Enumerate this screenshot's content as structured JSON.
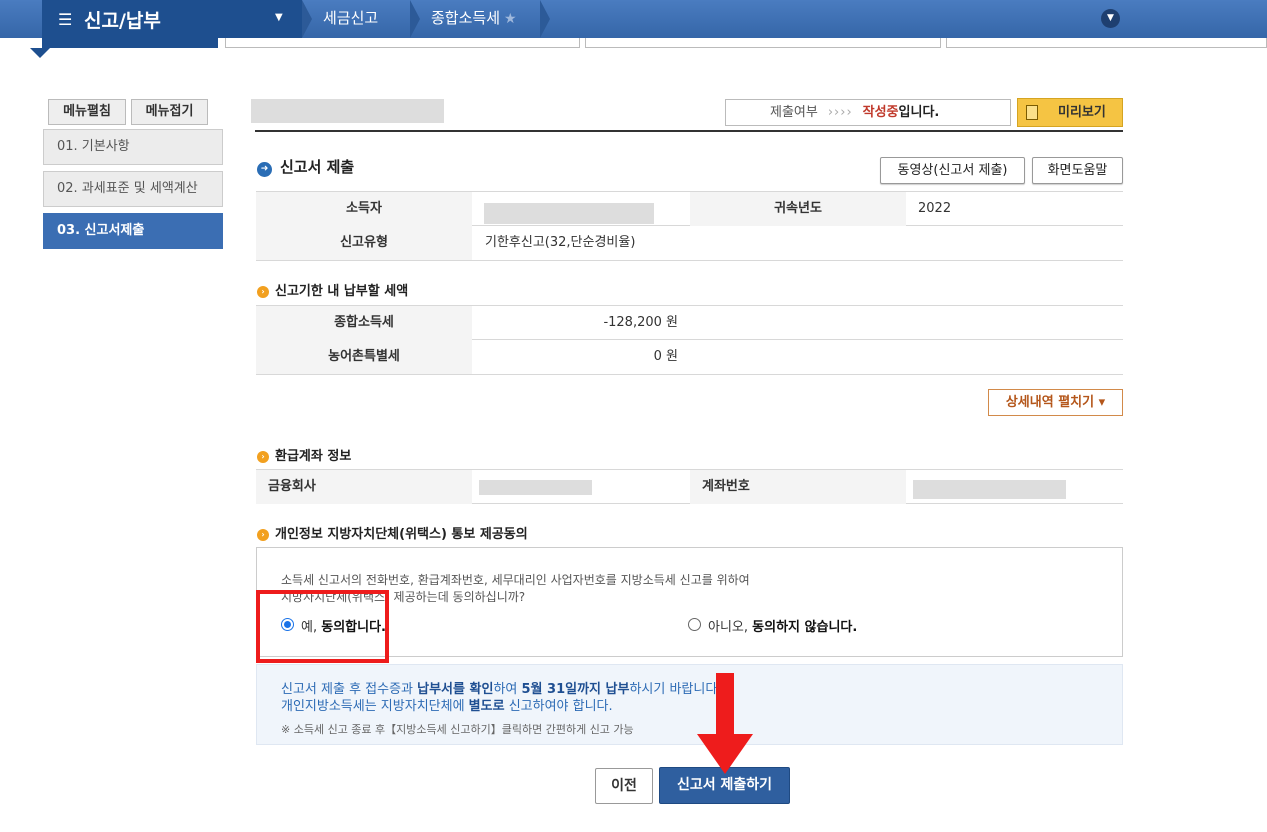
{
  "topnav": {
    "menu_title": "신고/납부",
    "breadcrumb": [
      "세금신고",
      "종합소득세"
    ]
  },
  "sidebar": {
    "edit_label": "메뉴펼침",
    "collapse_label": "메뉴접기",
    "items": [
      {
        "label": "01. 기본사항",
        "active": false
      },
      {
        "label": "02. 과세표준 및 세액계산",
        "active": false
      },
      {
        "label": "03. 신고서제출",
        "active": true
      }
    ]
  },
  "header": {
    "status_prefix": "제출여부",
    "status_arrows": "››››",
    "status_value": "작성중",
    "status_suffix": "입니다.",
    "preview_label": "미리보기"
  },
  "section_main": {
    "title": "신고서 제출",
    "video_btn": "동영상(신고서 제출)",
    "help_btn": "화면도움말",
    "rows": [
      {
        "label": "소득자",
        "value": "",
        "label2": "귀속년도",
        "value2": "2022"
      },
      {
        "label": "신고유형",
        "value": "기한후신고(32,단순경비율)"
      }
    ]
  },
  "section_tax": {
    "title": "신고기한 내 납부할 세액",
    "rows": [
      {
        "label": "종합소득세",
        "value": "-128,200 원"
      },
      {
        "label": "농어촌특별세",
        "value": "0 원"
      }
    ],
    "detail_btn": "상세내역 펼치기 ▾"
  },
  "section_refund": {
    "title": "환급계좌 정보",
    "bank_label": "금융회사",
    "account_label": "계좌번호"
  },
  "section_consent": {
    "title": "개인정보 지방자치단체(위택스) 통보 제공동의",
    "text_line1": "소득세 신고서의 전화번호, 환급계좌번호, 세무대리인 사업자번호를 지방소득세 신고를 위하여",
    "text_line2": "지방자치단체(위택스) 제공하는데 동의하십니까?",
    "yes_prefix": "예, ",
    "yes_bold": "동의합니다.",
    "no_prefix": "아니오, ",
    "no_bold": "동의하지 않습니다."
  },
  "info": {
    "line1_a": "신고서 제출 후 접수증과 ",
    "line1_b": "납부서를 확인",
    "line1_c": "하여 ",
    "line1_d": "5월 31일까지 납부",
    "line1_e": "하시기 바랍니다.",
    "line2_a": "개인지방소득세는 지방자치단체에 ",
    "line2_b": "별도로",
    "line2_c": " 신고하여야 합니다.",
    "note": "※ 소득세 신고 종료 후【지방소득세 신고하기】클릭하면 간편하게 신고 가능"
  },
  "actions": {
    "prev_label": "이전",
    "submit_label": "신고서 제출하기"
  },
  "colors": {
    "nav_blue": "#3566a8",
    "accent_red": "#ee1c1c",
    "preview_yellow": "#f5c443",
    "submit_blue": "#2f5f9f"
  }
}
